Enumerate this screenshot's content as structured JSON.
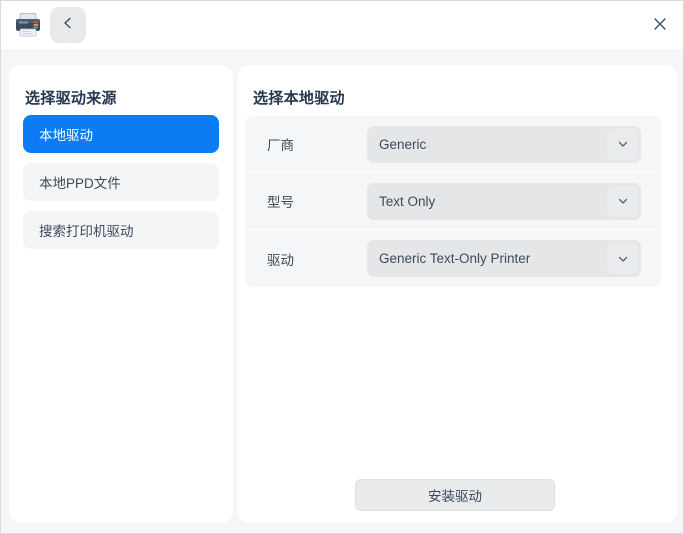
{
  "titlebar": {
    "app_icon": "printer-icon",
    "back_icon": "chevron-left-icon",
    "close_icon": "close-icon"
  },
  "sidebar": {
    "title": "选择驱动来源",
    "items": [
      {
        "label": "本地驱动",
        "selected": true
      },
      {
        "label": "本地PPD文件",
        "selected": false
      },
      {
        "label": "搜索打印机驱动",
        "selected": false
      }
    ]
  },
  "main": {
    "title": "选择本地驱动",
    "rows": [
      {
        "label": "厂商",
        "value": "Generic",
        "caret": "chevron-down-icon"
      },
      {
        "label": "型号",
        "value": "Text Only",
        "caret": "chevron-down-icon"
      },
      {
        "label": "驱动",
        "value": "Generic Text-Only Printer",
        "caret": "chevron-down-icon"
      }
    ],
    "install_label": "安装驱动"
  },
  "colors": {
    "accent": "#0c7cf5",
    "card": "#ffffff",
    "page_bg": "#f5f6f7",
    "field_bg": "#e5e6e8",
    "item_bg": "#f4f5f6",
    "text": "#3c4a5c",
    "title_text": "#25384f"
  }
}
